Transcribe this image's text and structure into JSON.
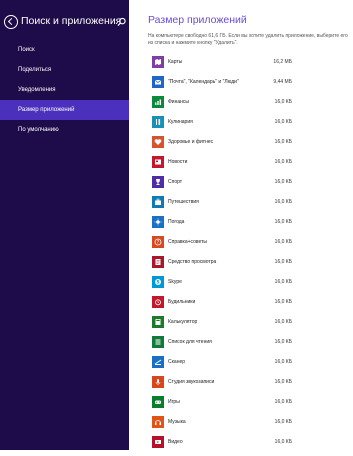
{
  "sidebar": {
    "title": "Поиск и приложения",
    "items": [
      {
        "label": "Поиск"
      },
      {
        "label": "Поделиться"
      },
      {
        "label": "Уведомления"
      },
      {
        "label": "Размер приложений"
      },
      {
        "label": "По умолчанию"
      }
    ],
    "active_index": 3,
    "background_color": "#1e0b4a",
    "active_color": "#4b2fbd"
  },
  "main": {
    "title": "Размер приложений",
    "description": "На компьютере свободно 61,6 ГБ. Если вы хотите удалить приложение, выберите его из списка и нажмите кнопку \"Удалить\".",
    "title_color": "#6b4dd6",
    "apps": [
      {
        "name": "Карты",
        "size": "16,2 МБ",
        "icon": "map-icon",
        "color": "#7e3ea3"
      },
      {
        "name": "\"Почта\", \"Календарь\" и \"Люди\"",
        "size": "9,44 МБ",
        "icon": "mail-icon",
        "color": "#1e66c8"
      },
      {
        "name": "Финансы",
        "size": "16,0 КБ",
        "icon": "chart-icon",
        "color": "#0c8a3b"
      },
      {
        "name": "Кулинария",
        "size": "16,0 КБ",
        "icon": "cooking-icon",
        "color": "#1a8fb8"
      },
      {
        "name": "Здоровье и фитнес",
        "size": "16,0 КБ",
        "icon": "heart-icon",
        "color": "#d6532b"
      },
      {
        "name": "Новости",
        "size": "16,0 КБ",
        "icon": "news-icon",
        "color": "#c2182b"
      },
      {
        "name": "Спорт",
        "size": "16,0 КБ",
        "icon": "trophy-icon",
        "color": "#4f2ea3"
      },
      {
        "name": "Путешествия",
        "size": "16,0 КБ",
        "icon": "suitcase-icon",
        "color": "#0e7bb3"
      },
      {
        "name": "Погода",
        "size": "16,0 КБ",
        "icon": "sun-icon",
        "color": "#1b6fc4"
      },
      {
        "name": "Справка+советы",
        "size": "16,0 КБ",
        "icon": "help-icon",
        "color": "#d64a1f"
      },
      {
        "name": "Средство просмотра",
        "size": "16,0 КБ",
        "icon": "reader-icon",
        "color": "#a8182a"
      },
      {
        "name": "Skype",
        "size": "16,0 КБ",
        "icon": "skype-icon",
        "color": "#0098d6"
      },
      {
        "name": "Будильники",
        "size": "16,0 КБ",
        "icon": "alarm-icon",
        "color": "#c3182b"
      },
      {
        "name": "Калькулятор",
        "size": "16,0 КБ",
        "icon": "calculator-icon",
        "color": "#1c7a2a"
      },
      {
        "name": "Список для чтения",
        "size": "16,0 КБ",
        "icon": "reading-list-icon",
        "color": "#0f7a3a"
      },
      {
        "name": "Сканер",
        "size": "16,0 КБ",
        "icon": "scanner-icon",
        "color": "#1a6fc4"
      },
      {
        "name": "Студия звукозаписи",
        "size": "16,0 КБ",
        "icon": "microphone-icon",
        "color": "#d8461c"
      },
      {
        "name": "Игры",
        "size": "16,0 КБ",
        "icon": "gamepad-icon",
        "color": "#0c7d2c"
      },
      {
        "name": "Музыка",
        "size": "16,0 КБ",
        "icon": "headphones-icon",
        "color": "#e0541a"
      },
      {
        "name": "Видео",
        "size": "16,0 КБ",
        "icon": "video-icon",
        "color": "#b5122a"
      }
    ]
  }
}
